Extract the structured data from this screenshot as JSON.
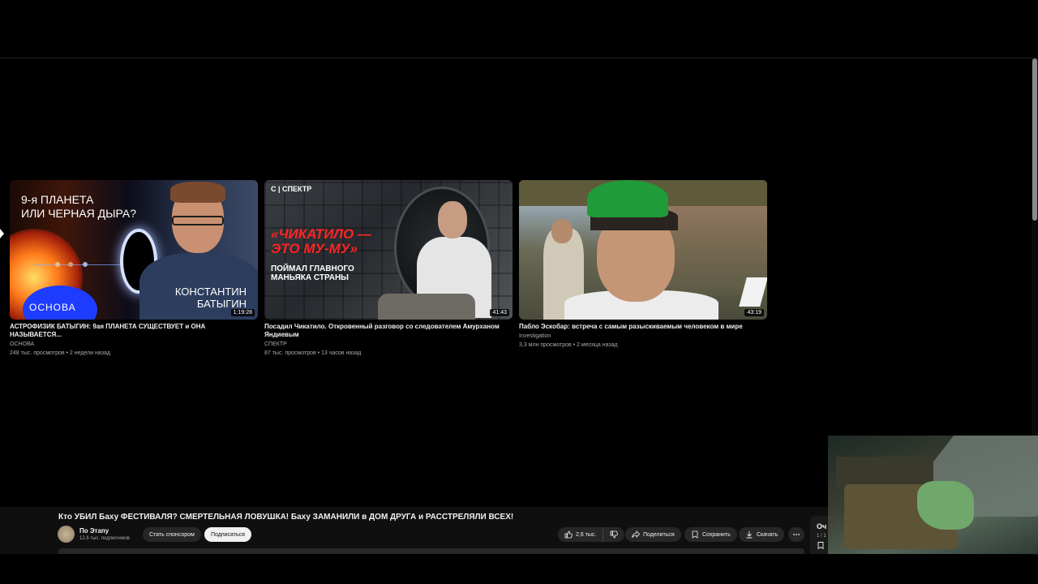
{
  "colors": {
    "background": "#000000",
    "bar": "#0f0f0f",
    "pill": "#272727",
    "subscribe_bg": "#f1f1f1",
    "secondary_text": "#aaaaaa"
  },
  "videos": [
    {
      "title": "АСТРОФИЗИК БАТЫГИН: 9ая ПЛАНЕТА СУЩЕСТВУЕТ и ОНА НАЗЫВАЕТСЯ...",
      "channel": "ОСНОВА",
      "meta": "248 тыс. просмотров • 2 недели назад",
      "duration": "1:19:28",
      "thumb_question": "9-я ПЛАНЕТА\nИЛИ ЧЕРНАЯ ДЫРА?",
      "thumb_name": "КОНСТАНТИН\nБАТЫГИН",
      "thumb_logo": "ОСНОВА"
    },
    {
      "title": "Посадил Чикатило. Откровенный разговор со следователем Амурханом Яндиевым",
      "channel": "СПЕКТР",
      "meta": "87 тыс. просмотров • 13 часов назад",
      "duration": "41:43",
      "thumb_brand": "С | СПЕКТР",
      "thumb_headline": "«ЧИКАТИЛО —\nЭТО МУ-МУ»",
      "thumb_sub": "ПОЙМАЛ ГЛАВНОГО\nМАНЬЯКА СТРАНЫ"
    },
    {
      "title": "Пабло Эскобар: встреча с самым разыскиваемым человеком в мире",
      "channel": "Investigation",
      "meta": "3,3 млн просмотров • 2 месяца назад",
      "duration": "43:19"
    }
  ],
  "now_playing": {
    "title": "Кто УБИЛ Баху ФЕСТИВАЛЯ? СМЕРТЕЛЬНАЯ ЛОВУШКА! Баху ЗАМАНИЛИ в ДОМ ДРУГА и РАССТРЕЛЯЛИ ВСЕХ!",
    "channel": "По Этапу",
    "subscribers": "12,6 тыс. подписчиков",
    "sponsor_label": "Стать спонсором",
    "subscribe_label": "Подписаться",
    "likes": "2,6 тыс.",
    "share_label": "Поделиться",
    "save_label": "Сохранить",
    "download_label": "Скачать"
  },
  "side_panel": {
    "title": "Оч",
    "count": "1 / 1"
  },
  "icons": {
    "like": "thumbs-up-icon",
    "dislike": "thumbs-down-icon",
    "share": "share-icon",
    "save": "save-icon",
    "download": "download-icon",
    "more": "more-icon",
    "bookmark": "bookmark-icon"
  }
}
